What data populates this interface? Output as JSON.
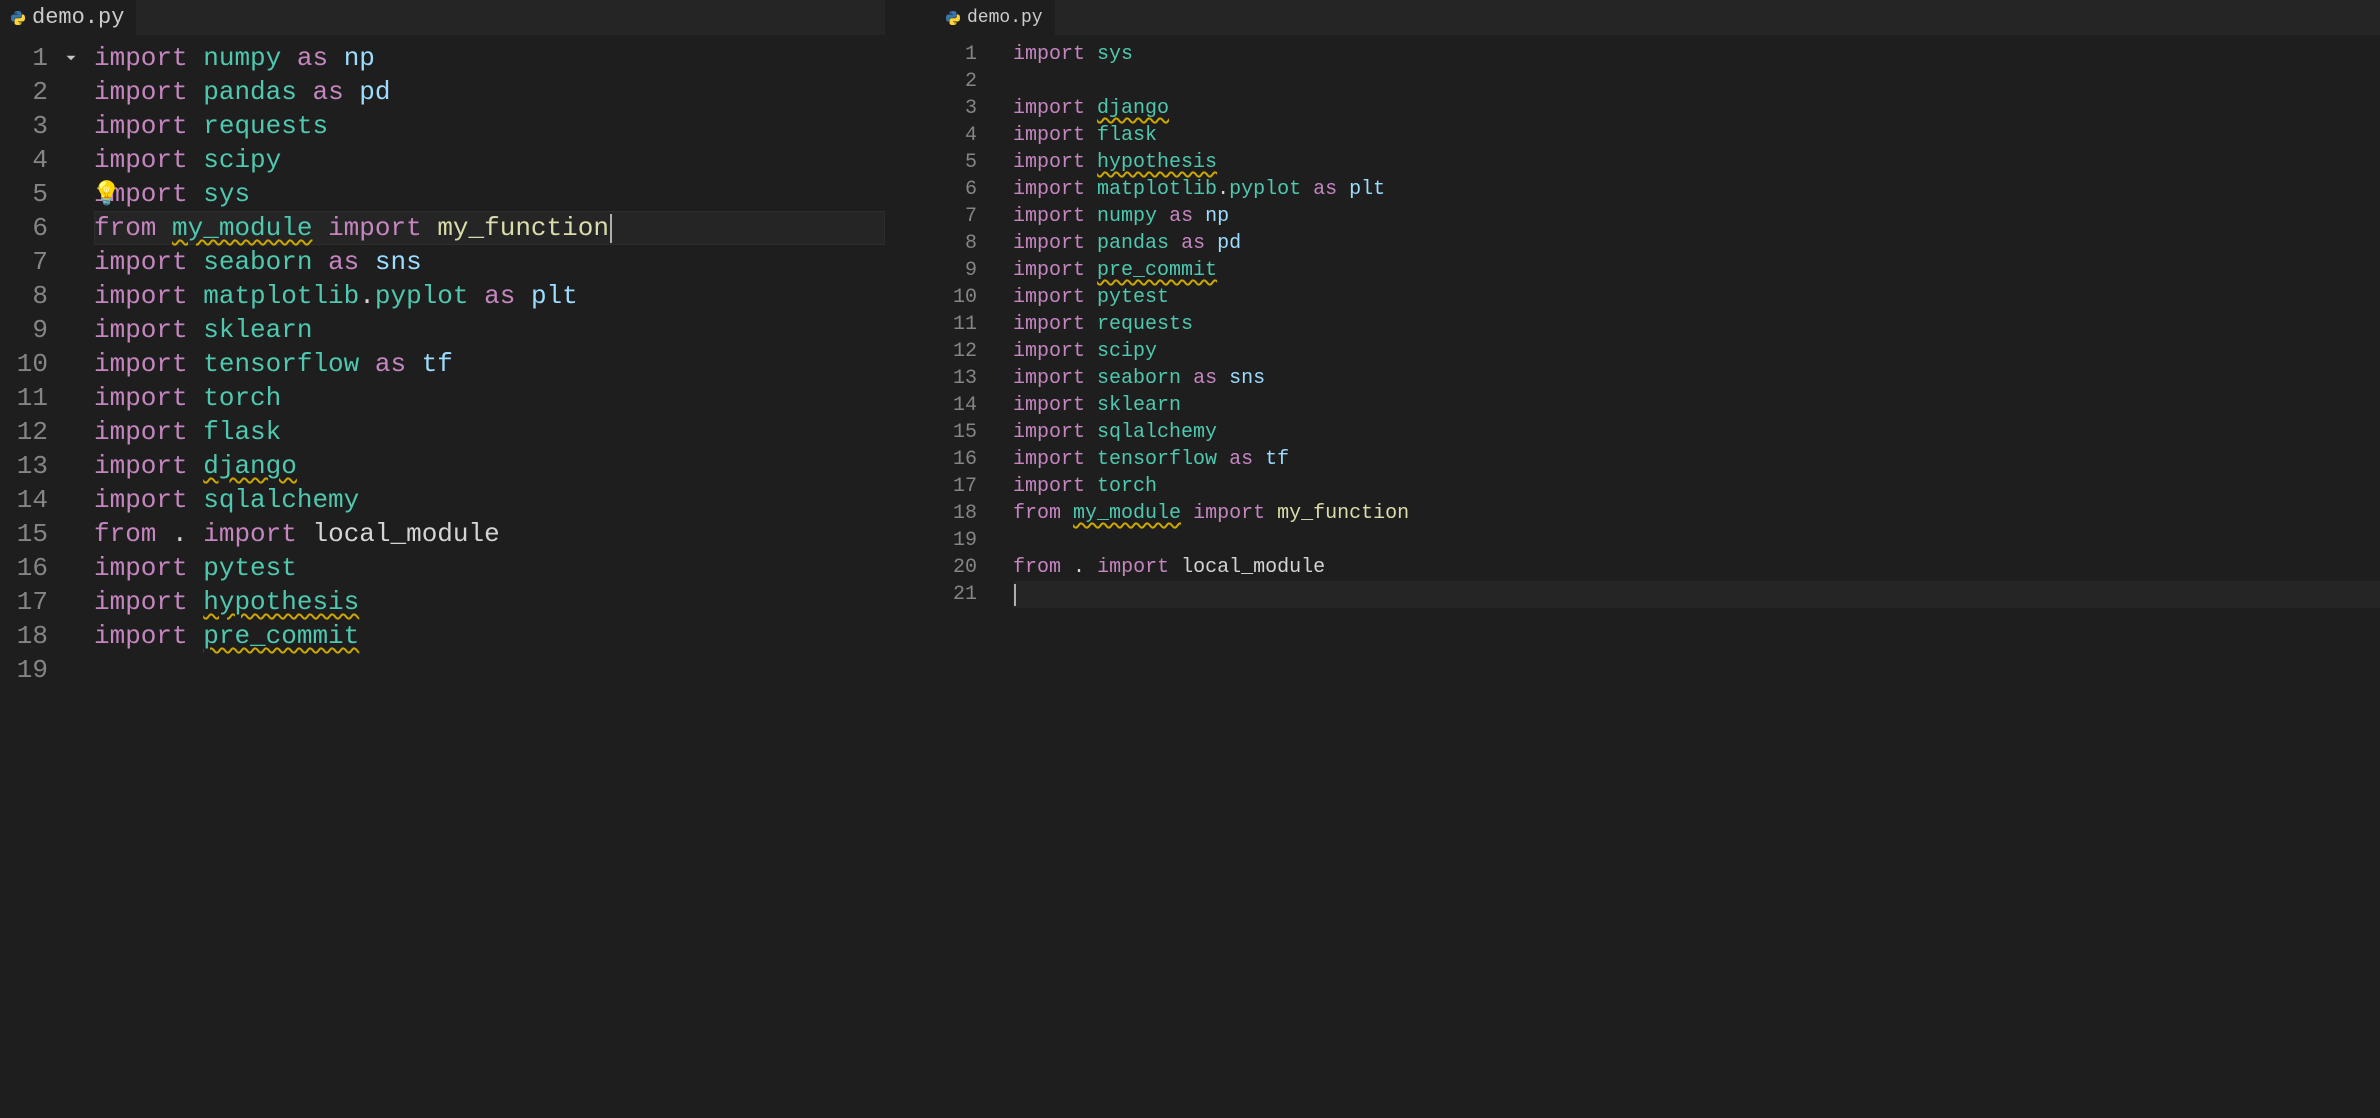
{
  "tabs": {
    "left": {
      "filename": "demo.py"
    },
    "right": {
      "filename": "demo.py"
    }
  },
  "left_editor": {
    "active_line": 6,
    "lightbulb_line": 5,
    "fold_line": 1,
    "line_count": 19,
    "lines": [
      {
        "n": 1,
        "tokens": [
          {
            "t": "import",
            "c": "k-import"
          },
          {
            "t": " "
          },
          {
            "t": "numpy",
            "c": "module"
          },
          {
            "t": " "
          },
          {
            "t": "as",
            "c": "k-as"
          },
          {
            "t": " "
          },
          {
            "t": "np",
            "c": "alias"
          }
        ]
      },
      {
        "n": 2,
        "tokens": [
          {
            "t": "import",
            "c": "k-import"
          },
          {
            "t": " "
          },
          {
            "t": "pandas",
            "c": "module"
          },
          {
            "t": " "
          },
          {
            "t": "as",
            "c": "k-as"
          },
          {
            "t": " "
          },
          {
            "t": "pd",
            "c": "alias"
          }
        ]
      },
      {
        "n": 3,
        "tokens": [
          {
            "t": "import",
            "c": "k-import"
          },
          {
            "t": " "
          },
          {
            "t": "requests",
            "c": "module"
          }
        ]
      },
      {
        "n": 4,
        "tokens": [
          {
            "t": "import",
            "c": "k-import"
          },
          {
            "t": " "
          },
          {
            "t": "scipy",
            "c": "module"
          }
        ]
      },
      {
        "n": 5,
        "tokens": [
          {
            "t": "import",
            "c": "k-import"
          },
          {
            "t": " "
          },
          {
            "t": "sys",
            "c": "module"
          }
        ]
      },
      {
        "n": 6,
        "tokens": [
          {
            "t": "from",
            "c": "k-from"
          },
          {
            "t": " "
          },
          {
            "t": "my_module",
            "c": "module",
            "warn": true
          },
          {
            "t": " "
          },
          {
            "t": "import",
            "c": "k-import"
          },
          {
            "t": " "
          },
          {
            "t": "my_function",
            "c": "func"
          }
        ],
        "cursor_after": true
      },
      {
        "n": 7,
        "tokens": [
          {
            "t": "import",
            "c": "k-import"
          },
          {
            "t": " "
          },
          {
            "t": "seaborn",
            "c": "module"
          },
          {
            "t": " "
          },
          {
            "t": "as",
            "c": "k-as"
          },
          {
            "t": " "
          },
          {
            "t": "sns",
            "c": "alias"
          }
        ]
      },
      {
        "n": 8,
        "tokens": [
          {
            "t": "import",
            "c": "k-import"
          },
          {
            "t": " "
          },
          {
            "t": "matplotlib",
            "c": "module"
          },
          {
            "t": ".",
            "c": "dot"
          },
          {
            "t": "pyplot",
            "c": "module"
          },
          {
            "t": " "
          },
          {
            "t": "as",
            "c": "k-as"
          },
          {
            "t": " "
          },
          {
            "t": "plt",
            "c": "alias"
          }
        ]
      },
      {
        "n": 9,
        "tokens": [
          {
            "t": "import",
            "c": "k-import"
          },
          {
            "t": " "
          },
          {
            "t": "sklearn",
            "c": "module"
          }
        ]
      },
      {
        "n": 10,
        "tokens": [
          {
            "t": "import",
            "c": "k-import"
          },
          {
            "t": " "
          },
          {
            "t": "tensorflow",
            "c": "module"
          },
          {
            "t": " "
          },
          {
            "t": "as",
            "c": "k-as"
          },
          {
            "t": " "
          },
          {
            "t": "tf",
            "c": "alias"
          }
        ]
      },
      {
        "n": 11,
        "tokens": [
          {
            "t": "import",
            "c": "k-import"
          },
          {
            "t": " "
          },
          {
            "t": "torch",
            "c": "module"
          }
        ]
      },
      {
        "n": 12,
        "tokens": [
          {
            "t": "import",
            "c": "k-import"
          },
          {
            "t": " "
          },
          {
            "t": "flask",
            "c": "module"
          }
        ]
      },
      {
        "n": 13,
        "tokens": [
          {
            "t": "import",
            "c": "k-import"
          },
          {
            "t": " "
          },
          {
            "t": "django",
            "c": "module",
            "warn": true
          }
        ]
      },
      {
        "n": 14,
        "tokens": [
          {
            "t": "import",
            "c": "k-import"
          },
          {
            "t": " "
          },
          {
            "t": "sqlalchemy",
            "c": "module"
          }
        ]
      },
      {
        "n": 15,
        "tokens": [
          {
            "t": "from",
            "c": "k-from"
          },
          {
            "t": " "
          },
          {
            "t": ".",
            "c": "punct"
          },
          {
            "t": " "
          },
          {
            "t": "import",
            "c": "k-import"
          },
          {
            "t": " "
          },
          {
            "t": "local_module",
            "c": "ident"
          }
        ]
      },
      {
        "n": 16,
        "tokens": [
          {
            "t": "import",
            "c": "k-import"
          },
          {
            "t": " "
          },
          {
            "t": "pytest",
            "c": "module"
          }
        ]
      },
      {
        "n": 17,
        "tokens": [
          {
            "t": "import",
            "c": "k-import"
          },
          {
            "t": " "
          },
          {
            "t": "hypothesis",
            "c": "module",
            "warn": true
          }
        ]
      },
      {
        "n": 18,
        "tokens": [
          {
            "t": "import",
            "c": "k-import"
          },
          {
            "t": " "
          },
          {
            "t": "pre_commit",
            "c": "module",
            "warn": true
          }
        ]
      },
      {
        "n": 19,
        "tokens": []
      }
    ]
  },
  "right_editor": {
    "active_line": 21,
    "line_count": 21,
    "lines": [
      {
        "n": 1,
        "tokens": [
          {
            "t": "import",
            "c": "k-import"
          },
          {
            "t": " "
          },
          {
            "t": "sys",
            "c": "module"
          }
        ]
      },
      {
        "n": 2,
        "tokens": []
      },
      {
        "n": 3,
        "tokens": [
          {
            "t": "import",
            "c": "k-import"
          },
          {
            "t": " "
          },
          {
            "t": "django",
            "c": "module",
            "warn": true
          }
        ]
      },
      {
        "n": 4,
        "tokens": [
          {
            "t": "import",
            "c": "k-import"
          },
          {
            "t": " "
          },
          {
            "t": "flask",
            "c": "module"
          }
        ]
      },
      {
        "n": 5,
        "tokens": [
          {
            "t": "import",
            "c": "k-import"
          },
          {
            "t": " "
          },
          {
            "t": "hypothesis",
            "c": "module",
            "warn": true
          }
        ]
      },
      {
        "n": 6,
        "tokens": [
          {
            "t": "import",
            "c": "k-import"
          },
          {
            "t": " "
          },
          {
            "t": "matplotlib",
            "c": "module"
          },
          {
            "t": ".",
            "c": "dot"
          },
          {
            "t": "pyplot",
            "c": "module"
          },
          {
            "t": " "
          },
          {
            "t": "as",
            "c": "k-as"
          },
          {
            "t": " "
          },
          {
            "t": "plt",
            "c": "alias"
          }
        ]
      },
      {
        "n": 7,
        "tokens": [
          {
            "t": "import",
            "c": "k-import"
          },
          {
            "t": " "
          },
          {
            "t": "numpy",
            "c": "module"
          },
          {
            "t": " "
          },
          {
            "t": "as",
            "c": "k-as"
          },
          {
            "t": " "
          },
          {
            "t": "np",
            "c": "alias"
          }
        ]
      },
      {
        "n": 8,
        "tokens": [
          {
            "t": "import",
            "c": "k-import"
          },
          {
            "t": " "
          },
          {
            "t": "pandas",
            "c": "module"
          },
          {
            "t": " "
          },
          {
            "t": "as",
            "c": "k-as"
          },
          {
            "t": " "
          },
          {
            "t": "pd",
            "c": "alias"
          }
        ]
      },
      {
        "n": 9,
        "tokens": [
          {
            "t": "import",
            "c": "k-import"
          },
          {
            "t": " "
          },
          {
            "t": "pre_commit",
            "c": "module",
            "warn": true
          }
        ]
      },
      {
        "n": 10,
        "tokens": [
          {
            "t": "import",
            "c": "k-import"
          },
          {
            "t": " "
          },
          {
            "t": "pytest",
            "c": "module"
          }
        ]
      },
      {
        "n": 11,
        "tokens": [
          {
            "t": "import",
            "c": "k-import"
          },
          {
            "t": " "
          },
          {
            "t": "requests",
            "c": "module"
          }
        ]
      },
      {
        "n": 12,
        "tokens": [
          {
            "t": "import",
            "c": "k-import"
          },
          {
            "t": " "
          },
          {
            "t": "scipy",
            "c": "module"
          }
        ]
      },
      {
        "n": 13,
        "tokens": [
          {
            "t": "import",
            "c": "k-import"
          },
          {
            "t": " "
          },
          {
            "t": "seaborn",
            "c": "module"
          },
          {
            "t": " "
          },
          {
            "t": "as",
            "c": "k-as"
          },
          {
            "t": " "
          },
          {
            "t": "sns",
            "c": "alias"
          }
        ]
      },
      {
        "n": 14,
        "tokens": [
          {
            "t": "import",
            "c": "k-import"
          },
          {
            "t": " "
          },
          {
            "t": "sklearn",
            "c": "module"
          }
        ]
      },
      {
        "n": 15,
        "tokens": [
          {
            "t": "import",
            "c": "k-import"
          },
          {
            "t": " "
          },
          {
            "t": "sqlalchemy",
            "c": "module"
          }
        ]
      },
      {
        "n": 16,
        "tokens": [
          {
            "t": "import",
            "c": "k-import"
          },
          {
            "t": " "
          },
          {
            "t": "tensorflow",
            "c": "module"
          },
          {
            "t": " "
          },
          {
            "t": "as",
            "c": "k-as"
          },
          {
            "t": " "
          },
          {
            "t": "tf",
            "c": "alias"
          }
        ]
      },
      {
        "n": 17,
        "tokens": [
          {
            "t": "import",
            "c": "k-import"
          },
          {
            "t": " "
          },
          {
            "t": "torch",
            "c": "module"
          }
        ]
      },
      {
        "n": 18,
        "tokens": [
          {
            "t": "from",
            "c": "k-from"
          },
          {
            "t": " "
          },
          {
            "t": "my_module",
            "c": "module",
            "warn": true
          },
          {
            "t": " "
          },
          {
            "t": "import",
            "c": "k-import"
          },
          {
            "t": " "
          },
          {
            "t": "my_function",
            "c": "func"
          }
        ]
      },
      {
        "n": 19,
        "tokens": []
      },
      {
        "n": 20,
        "tokens": [
          {
            "t": "from",
            "c": "k-from"
          },
          {
            "t": " "
          },
          {
            "t": ".",
            "c": "punct"
          },
          {
            "t": " "
          },
          {
            "t": "import",
            "c": "k-import"
          },
          {
            "t": " "
          },
          {
            "t": "local_module",
            "c": "ident"
          }
        ]
      },
      {
        "n": 21,
        "tokens": [],
        "cursor_after": true
      }
    ]
  }
}
